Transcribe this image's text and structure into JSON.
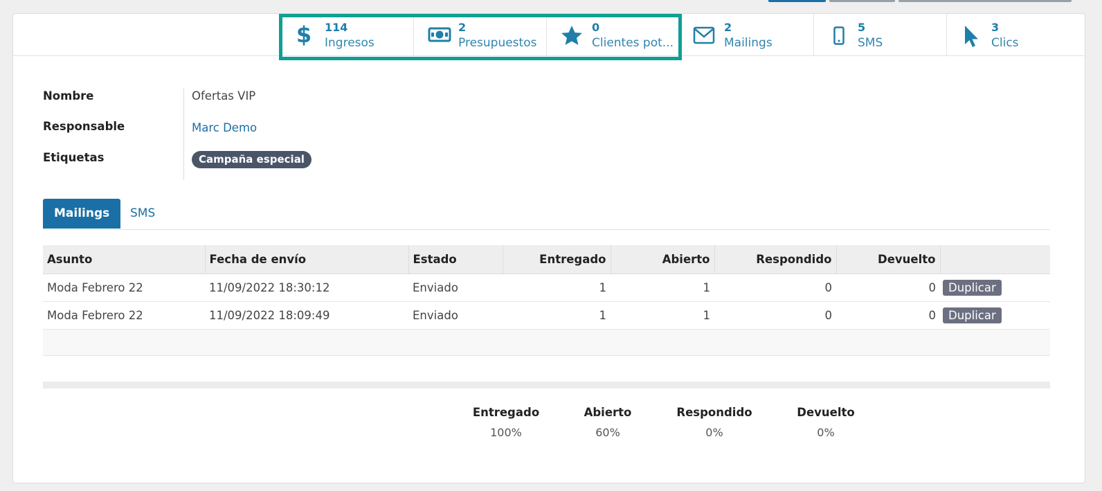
{
  "colors": {
    "accent": "#1a6fa6",
    "stat_text": "#2f86b0",
    "highlight_border": "#0f9f94",
    "tag_bg": "#4a5568",
    "button_bg": "#6b6f80"
  },
  "stats": [
    {
      "icon": "dollar-icon",
      "value": "114",
      "label": "Ingresos"
    },
    {
      "icon": "money-bill-icon",
      "value": "2",
      "label": "Presupuestos"
    },
    {
      "icon": "star-icon",
      "value": "0",
      "label": "Clientes pot..."
    },
    {
      "icon": "envelope-icon",
      "value": "2",
      "label": "Mailings"
    },
    {
      "icon": "mobile-phone-icon",
      "value": "5",
      "label": "SMS"
    },
    {
      "icon": "mouse-pointer-icon",
      "value": "3",
      "label": "Clics"
    }
  ],
  "form": {
    "name_label": "Nombre",
    "name_value": "Ofertas VIP",
    "responsible_label": "Responsable",
    "responsible_value": "Marc Demo",
    "tags_label": "Etiquetas",
    "tags": [
      "Campaña especial"
    ]
  },
  "tabs": [
    {
      "label": "Mailings",
      "active": true
    },
    {
      "label": "SMS",
      "active": false
    }
  ],
  "table": {
    "columns": [
      "Asunto",
      "Fecha de envío",
      "Estado",
      "Entregado",
      "Abierto",
      "Respondido",
      "Devuelto"
    ],
    "rows": [
      {
        "subject": "Moda Febrero 22",
        "date": "11/09/2022 18:30:12",
        "status": "Enviado",
        "delivered": "1",
        "opened": "1",
        "replied": "0",
        "bounced": "0",
        "action": "Duplicar"
      },
      {
        "subject": "Moda Febrero 22",
        "date": "11/09/2022 18:09:49",
        "status": "Enviado",
        "delivered": "1",
        "opened": "1",
        "replied": "0",
        "bounced": "0",
        "action": "Duplicar"
      }
    ]
  },
  "totals": [
    {
      "label": "Entregado",
      "value": "100%"
    },
    {
      "label": "Abierto",
      "value": "60%"
    },
    {
      "label": "Respondido",
      "value": "0%"
    },
    {
      "label": "Devuelto",
      "value": "0%"
    }
  ]
}
